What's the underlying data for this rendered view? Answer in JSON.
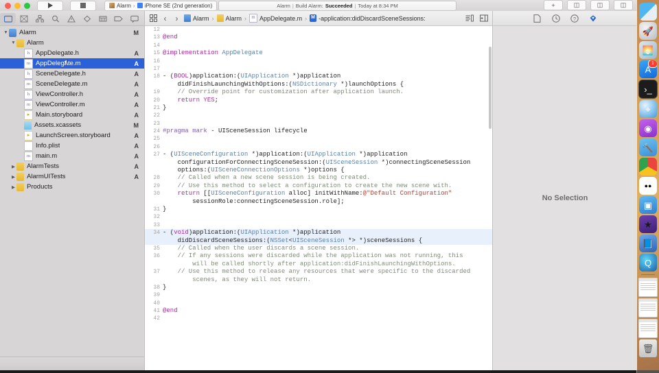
{
  "window": {
    "title": "Alarm",
    "run_button": "run-button",
    "stop_button": "stop-button",
    "scheme_project": "Alarm",
    "scheme_device": "iPhone SE (2nd generation)",
    "status_project": "Alarm",
    "status_action": "Build Alarm:",
    "status_result": "Succeeded",
    "status_time": "Today at 8:34 PM"
  },
  "navigator": {
    "tabs": [
      {
        "name": "project-navigator",
        "icon": "folder-icon",
        "active": true
      },
      {
        "name": "source-control-navigator",
        "icon": "source-control-icon",
        "active": false
      },
      {
        "name": "symbol-navigator",
        "icon": "symbol-hierarchy-icon",
        "active": false
      },
      {
        "name": "find-navigator",
        "icon": "search-icon",
        "active": false
      },
      {
        "name": "issue-navigator",
        "icon": "warning-triangle-icon",
        "active": false
      },
      {
        "name": "test-navigator",
        "icon": "diamond-icon",
        "active": false
      },
      {
        "name": "debug-navigator",
        "icon": "debug-gauge-icon",
        "active": false
      },
      {
        "name": "breakpoint-navigator",
        "icon": "breakpoint-icon",
        "active": false
      },
      {
        "name": "report-navigator",
        "icon": "report-bubble-icon",
        "active": false
      }
    ],
    "items": [
      {
        "label": "Alarm",
        "icon": "project-icon",
        "indent": 0,
        "disclosure": "open",
        "status": "M",
        "selected": false
      },
      {
        "label": "Alarm",
        "icon": "folder-icon",
        "indent": 1,
        "disclosure": "open",
        "status": "",
        "selected": false
      },
      {
        "label": "AppDelegate.h",
        "icon": "header-file-icon",
        "indent": 2,
        "disclosure": "",
        "status": "A",
        "selected": false
      },
      {
        "label": "AppDelegate.m",
        "icon": "implementation-file-icon",
        "indent": 2,
        "disclosure": "",
        "status": "A",
        "selected": true
      },
      {
        "label": "SceneDelegate.h",
        "icon": "header-file-icon",
        "indent": 2,
        "disclosure": "",
        "status": "A",
        "selected": false
      },
      {
        "label": "SceneDelegate.m",
        "icon": "implementation-file-icon",
        "indent": 2,
        "disclosure": "",
        "status": "A",
        "selected": false
      },
      {
        "label": "ViewController.h",
        "icon": "header-file-icon",
        "indent": 2,
        "disclosure": "",
        "status": "A",
        "selected": false
      },
      {
        "label": "ViewController.m",
        "icon": "implementation-file-icon",
        "indent": 2,
        "disclosure": "",
        "status": "A",
        "selected": false
      },
      {
        "label": "Main.storyboard",
        "icon": "storyboard-icon",
        "indent": 2,
        "disclosure": "",
        "status": "A",
        "selected": false
      },
      {
        "label": "Assets.xcassets",
        "icon": "assets-icon",
        "indent": 2,
        "disclosure": "",
        "status": "M",
        "selected": false
      },
      {
        "label": "LaunchScreen.storyboard",
        "icon": "storyboard-icon",
        "indent": 2,
        "disclosure": "",
        "status": "A",
        "selected": false
      },
      {
        "label": "Info.plist",
        "icon": "plist-icon",
        "indent": 2,
        "disclosure": "",
        "status": "A",
        "selected": false
      },
      {
        "label": "main.m",
        "icon": "implementation-file-icon",
        "indent": 2,
        "disclosure": "",
        "status": "A",
        "selected": false
      },
      {
        "label": "AlarmTests",
        "icon": "folder-icon",
        "indent": 1,
        "disclosure": "closed",
        "status": "A",
        "selected": false
      },
      {
        "label": "AlarmUITests",
        "icon": "folder-icon",
        "indent": 1,
        "disclosure": "closed",
        "status": "A",
        "selected": false
      },
      {
        "label": "Products",
        "icon": "folder-icon",
        "indent": 1,
        "disclosure": "closed",
        "status": "",
        "selected": false
      }
    ]
  },
  "jumpbar": {
    "related_items_icon": "related-items-icon",
    "back_label": "‹",
    "forward_label": "›",
    "crumbs": [
      {
        "label": "Alarm",
        "icon": "project-icon"
      },
      {
        "label": "Alarm",
        "icon": "folder-icon"
      },
      {
        "label": "AppDelegate.m",
        "icon": "implementation-file-icon"
      },
      {
        "label": "-application:didDiscardSceneSessions:",
        "icon": "method-icon"
      }
    ],
    "right_icons": [
      "minimap-icon",
      "assistant-editor-icon"
    ]
  },
  "editor": {
    "first_line": 12,
    "lines": [
      {
        "n": 12,
        "hl": false,
        "tokens": []
      },
      {
        "n": 13,
        "hl": false,
        "tokens": [
          {
            "t": "@end",
            "c": "k"
          }
        ]
      },
      {
        "n": 14,
        "hl": false,
        "tokens": []
      },
      {
        "n": 15,
        "hl": false,
        "tokens": [
          {
            "t": "@implementation ",
            "c": "k"
          },
          {
            "t": "AppDelegate",
            "c": "ty"
          }
        ]
      },
      {
        "n": 16,
        "hl": false,
        "tokens": []
      },
      {
        "n": 17,
        "hl": false,
        "tokens": []
      },
      {
        "n": 18,
        "hl": false,
        "tokens": [
          {
            "t": "- (",
            "c": "pl"
          },
          {
            "t": "BOOL",
            "c": "k"
          },
          {
            "t": ")application:(",
            "c": "pl"
          },
          {
            "t": "UIApplication",
            "c": "ty"
          },
          {
            "t": " *)application",
            "c": "pl"
          }
        ]
      },
      {
        "n": "",
        "hl": false,
        "tokens": [
          {
            "t": "    didFinishLaunchingWithOptions:(",
            "c": "pl"
          },
          {
            "t": "NSDictionary",
            "c": "ty"
          },
          {
            "t": " *)launchOptions {",
            "c": "pl"
          }
        ]
      },
      {
        "n": 19,
        "hl": false,
        "tokens": [
          {
            "t": "    // Override point for customization after application launch.",
            "c": "cm"
          }
        ]
      },
      {
        "n": 20,
        "hl": false,
        "tokens": [
          {
            "t": "    ",
            "c": "pl"
          },
          {
            "t": "return YES",
            "c": "k"
          },
          {
            "t": ";",
            "c": "pl"
          }
        ]
      },
      {
        "n": 21,
        "hl": false,
        "tokens": [
          {
            "t": "}",
            "c": "pl"
          }
        ]
      },
      {
        "n": 22,
        "hl": false,
        "tokens": []
      },
      {
        "n": 23,
        "hl": false,
        "tokens": []
      },
      {
        "n": 24,
        "hl": false,
        "tokens": [
          {
            "t": "#pragma mark ",
            "c": "pr"
          },
          {
            "t": "- UISceneSession lifecycle",
            "c": "pl"
          }
        ]
      },
      {
        "n": 25,
        "hl": false,
        "tokens": []
      },
      {
        "n": 26,
        "hl": false,
        "tokens": []
      },
      {
        "n": 27,
        "hl": false,
        "tokens": [
          {
            "t": "- (",
            "c": "pl"
          },
          {
            "t": "UISceneConfiguration",
            "c": "ty"
          },
          {
            "t": " *)application:(",
            "c": "pl"
          },
          {
            "t": "UIApplication",
            "c": "ty"
          },
          {
            "t": " *)application",
            "c": "pl"
          }
        ]
      },
      {
        "n": "",
        "hl": false,
        "tokens": [
          {
            "t": "    configurationForConnectingSceneSession:(",
            "c": "pl"
          },
          {
            "t": "UISceneSession",
            "c": "ty"
          },
          {
            "t": " *)connectingSceneSession",
            "c": "pl"
          }
        ]
      },
      {
        "n": "",
        "hl": false,
        "tokens": [
          {
            "t": "    options:(",
            "c": "pl"
          },
          {
            "t": "UISceneConnectionOptions",
            "c": "ty"
          },
          {
            "t": " *)options {",
            "c": "pl"
          }
        ]
      },
      {
        "n": 28,
        "hl": false,
        "tokens": [
          {
            "t": "    // Called when a new scene session is being created.",
            "c": "cm"
          }
        ]
      },
      {
        "n": 29,
        "hl": false,
        "tokens": [
          {
            "t": "    // Use this method to select a configuration to create the new scene with.",
            "c": "cm"
          }
        ]
      },
      {
        "n": 30,
        "hl": false,
        "tokens": [
          {
            "t": "    ",
            "c": "pl"
          },
          {
            "t": "return",
            "c": "k"
          },
          {
            "t": " [[",
            "c": "pl"
          },
          {
            "t": "UISceneConfiguration",
            "c": "ty"
          },
          {
            "t": " alloc] initWithName:",
            "c": "pl"
          },
          {
            "t": "@\"Default Configuration\"",
            "c": "st"
          }
        ]
      },
      {
        "n": "",
        "hl": false,
        "tokens": [
          {
            "t": "        sessionRole:connectingSceneSession.role];",
            "c": "pl"
          }
        ]
      },
      {
        "n": 31,
        "hl": false,
        "tokens": [
          {
            "t": "}",
            "c": "pl"
          }
        ]
      },
      {
        "n": 32,
        "hl": false,
        "tokens": []
      },
      {
        "n": 33,
        "hl": false,
        "tokens": []
      },
      {
        "n": 34,
        "hl": true,
        "tokens": [
          {
            "t": "- (",
            "c": "pl"
          },
          {
            "t": "void",
            "c": "k"
          },
          {
            "t": ")application:(",
            "c": "pl"
          },
          {
            "t": "UIApplication",
            "c": "ty"
          },
          {
            "t": " *)application",
            "c": "pl"
          }
        ]
      },
      {
        "n": "",
        "hl": true,
        "tokens": [
          {
            "t": "    didDiscardSceneSessions:(",
            "c": "pl"
          },
          {
            "t": "NSSet",
            "c": "ty"
          },
          {
            "t": "<",
            "c": "pl"
          },
          {
            "t": "UISceneSession",
            "c": "ty"
          },
          {
            "t": " *> *)sceneSessions {",
            "c": "pl"
          }
        ]
      },
      {
        "n": 35,
        "hl": false,
        "tokens": [
          {
            "t": "    // Called when the user discards a scene session.",
            "c": "cm"
          }
        ]
      },
      {
        "n": 36,
        "hl": false,
        "tokens": [
          {
            "t": "    // If any sessions were discarded while the application was not running, this",
            "c": "cm"
          }
        ]
      },
      {
        "n": "",
        "hl": false,
        "tokens": [
          {
            "t": "        will be called shortly after application:didFinishLaunchingWithOptions.",
            "c": "cm"
          }
        ]
      },
      {
        "n": 37,
        "hl": false,
        "tokens": [
          {
            "t": "    // Use this method to release any resources that were specific to the discarded",
            "c": "cm"
          }
        ]
      },
      {
        "n": "",
        "hl": false,
        "tokens": [
          {
            "t": "        scenes, as they will not return.",
            "c": "cm"
          }
        ]
      },
      {
        "n": 38,
        "hl": false,
        "tokens": [
          {
            "t": "}",
            "c": "pl"
          }
        ]
      },
      {
        "n": 39,
        "hl": false,
        "tokens": []
      },
      {
        "n": 40,
        "hl": false,
        "tokens": []
      },
      {
        "n": 41,
        "hl": false,
        "tokens": [
          {
            "t": "@end",
            "c": "k"
          }
        ]
      },
      {
        "n": 42,
        "hl": false,
        "tokens": []
      }
    ]
  },
  "inspector": {
    "tabs": [
      {
        "name": "file-inspector",
        "icon": "document-icon",
        "active": false
      },
      {
        "name": "history-inspector",
        "icon": "clock-icon",
        "active": false
      },
      {
        "name": "quick-help-inspector",
        "icon": "help-circle-icon",
        "active": false
      },
      {
        "name": "location-inspector",
        "icon": "location-pin-icon",
        "active": true
      }
    ],
    "empty_message": "No Selection"
  },
  "dock": {
    "items": [
      {
        "name": "finder",
        "label": "Finder",
        "running": true,
        "badge": ""
      },
      {
        "name": "launchpad",
        "label": "Launchpad",
        "running": false,
        "badge": ""
      },
      {
        "name": "photos",
        "label": "Photos",
        "running": false,
        "badge": ""
      },
      {
        "name": "app-store",
        "label": "App Store",
        "running": false,
        "badge": "1"
      },
      {
        "name": "terminal",
        "label": "Terminal",
        "running": true,
        "badge": ""
      },
      {
        "name": "safari",
        "label": "Safari",
        "running": false,
        "badge": ""
      },
      {
        "name": "podcasts",
        "label": "Podcasts",
        "running": false,
        "badge": ""
      },
      {
        "name": "xcode",
        "label": "Xcode",
        "running": true,
        "badge": ""
      },
      {
        "name": "chrome",
        "label": "Google Chrome",
        "running": true,
        "badge": ""
      },
      {
        "name": "zoom",
        "label": "zoom.us",
        "running": true,
        "badge": ""
      },
      {
        "name": "keynote",
        "label": "Keynote",
        "running": true,
        "badge": ""
      },
      {
        "name": "imovie",
        "label": "iMovie",
        "running": true,
        "badge": ""
      },
      {
        "name": "dictionary",
        "label": "Dictionary",
        "running": true,
        "badge": ""
      },
      {
        "name": "quicktime",
        "label": "QuickTime Player",
        "running": true,
        "badge": ""
      }
    ],
    "minimized": [
      {
        "name": "minimized-window-chrome",
        "label": "Chrome window"
      },
      {
        "name": "minimized-window-document",
        "label": "Document window"
      },
      {
        "name": "minimized-window-media",
        "label": "Media window"
      }
    ],
    "trash": {
      "name": "trash",
      "label": "Trash"
    }
  }
}
